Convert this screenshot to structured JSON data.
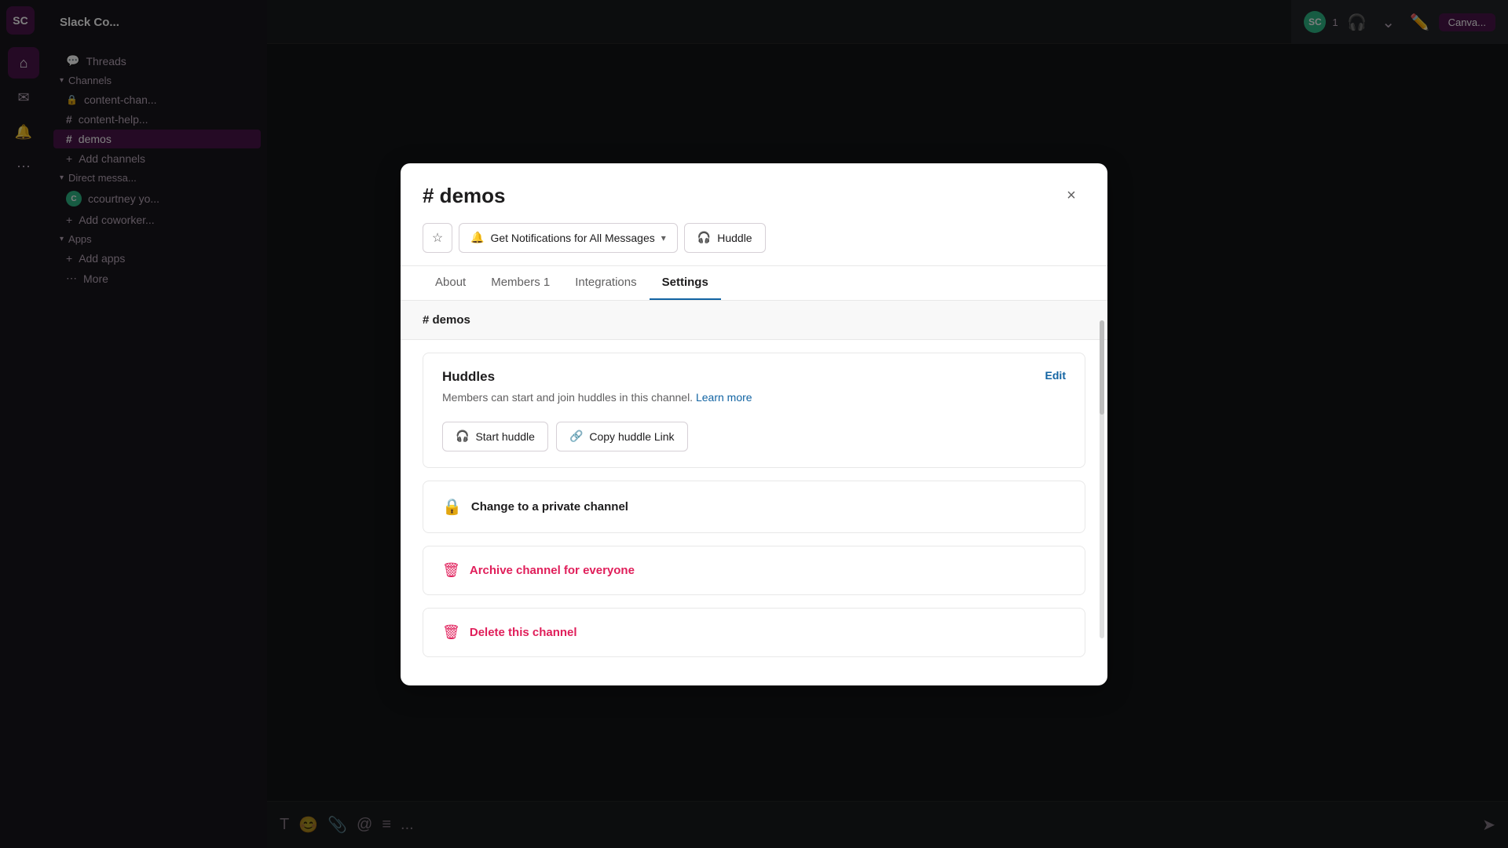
{
  "workspace": {
    "name": "Slack Co...",
    "initials": "SC"
  },
  "sidebar": {
    "sections": [
      {
        "label": "Channels",
        "items": [
          {
            "name": "content-chan...",
            "type": "lock",
            "active": false
          },
          {
            "name": "content-help...",
            "type": "hash",
            "active": false
          },
          {
            "name": "demos",
            "type": "hash",
            "active": true
          }
        ]
      },
      {
        "label": "Direct messa...",
        "items": [
          {
            "name": "ccourtney  yo...",
            "type": "avatar",
            "active": false
          }
        ]
      },
      {
        "label": "Apps",
        "items": []
      }
    ],
    "nav_items": [
      {
        "name": "Home",
        "icon": "⌂"
      },
      {
        "name": "DMs",
        "icon": "✉"
      },
      {
        "name": "Activity",
        "icon": "🔔"
      },
      {
        "name": "More",
        "icon": "⋯"
      }
    ],
    "add_channels": "Add channels",
    "add_coworkers": "Add coworker...",
    "add_apps": "Add apps",
    "threads_label": "Threads"
  },
  "modal": {
    "title": "# demos",
    "close_label": "×",
    "star_label": "☆",
    "notifications_label": "Get Notifications for All Messages",
    "huddle_label": "Huddle",
    "tabs": [
      {
        "id": "about",
        "label": "About"
      },
      {
        "id": "members",
        "label": "Members 1"
      },
      {
        "id": "integrations",
        "label": "Integrations"
      },
      {
        "id": "settings",
        "label": "Settings",
        "active": true
      }
    ],
    "channel_name": "# demos",
    "huddles_section": {
      "title": "Huddles",
      "description": "Members can start and join huddles in this channel.",
      "learn_more": "Learn more",
      "edit_label": "Edit",
      "start_huddle_label": "Start huddle",
      "copy_huddle_label": "Copy huddle Link"
    },
    "private_section": {
      "label": "Change to a private channel"
    },
    "archive_section": {
      "label": "Archive channel for everyone"
    },
    "delete_section": {
      "label": "Delete this channel"
    }
  },
  "topbar": {
    "avatar_text": "SC",
    "canvas_label": "Canva..."
  },
  "colors": {
    "accent": "#1264a3",
    "danger": "#e01e5a",
    "active_tab_border": "#1264a3",
    "sidebar_bg": "#19171d",
    "modal_bg": "#ffffff"
  }
}
